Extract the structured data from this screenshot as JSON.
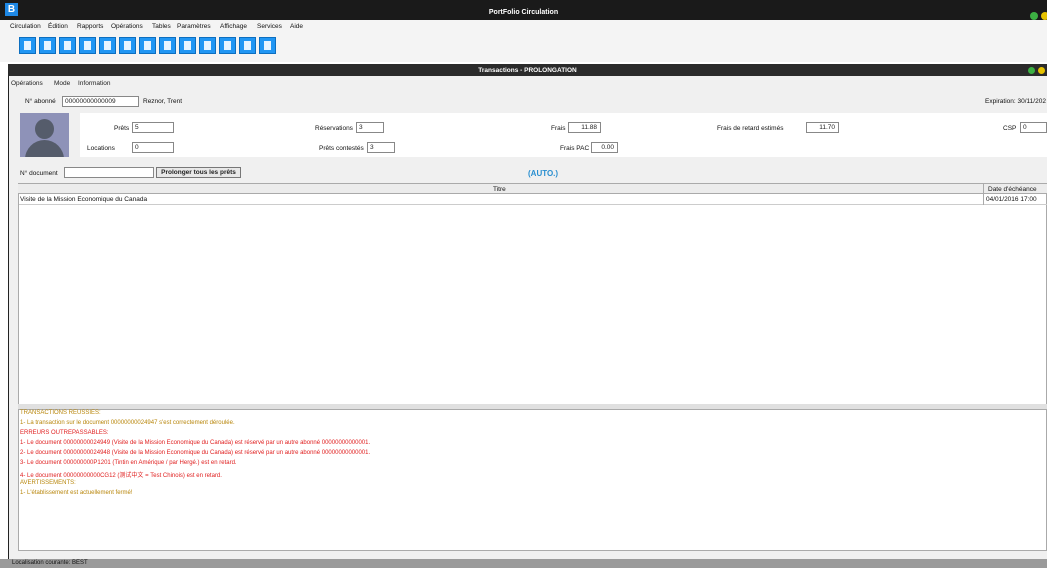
{
  "app": {
    "title": "PortFolio Circulation",
    "logo": "B"
  },
  "menubar": [
    "Circulation",
    "Édition",
    "Rapports",
    "Opérations",
    "Tables",
    "Paramètres",
    "Affichage",
    "Services",
    "Aide"
  ],
  "toolbar": {
    "icons": [
      "document-icon",
      "document-icon",
      "document-icon",
      "list-icon",
      "upload-icon",
      "download-icon",
      "list-icon",
      "user-card-icon",
      "user-card-icon",
      "report-icon",
      "scissors-icon",
      "copy-icon",
      "paste-icon"
    ],
    "color": "#2196f3"
  },
  "window": {
    "title": "Transactions - PROLONGATION",
    "menu": [
      "Opérations",
      "Mode",
      "Information"
    ]
  },
  "patron": {
    "label": "N° abonné",
    "number": "00000000000009",
    "name": "Reznor, Trent",
    "expiration": "Expiration: 30/11/202",
    "prets_label": "Prêts",
    "prets": "5",
    "locations_label": "Locations",
    "locations": "0",
    "reservations_label": "Réservations",
    "reservations": "3",
    "prets_contestes_label": "Prêts contestés",
    "prets_contestes": "3",
    "frais_label": "Frais",
    "frais": "11.88",
    "frais_pac_label": "Frais PAC",
    "frais_pac": "0.00",
    "frais_retard_label": "Frais de retard estimés",
    "frais_retard": "11.70",
    "csp_label": "CSP",
    "csp": "0"
  },
  "document": {
    "label": "N° document",
    "value": "",
    "button": "Prolonger tous les prêts",
    "mode": "(AUTO.)"
  },
  "table": {
    "columns": [
      "Titre",
      "Date d'échéance"
    ],
    "rows": [
      {
        "titre": "Visite de la Mission Economique du Canada",
        "date": "04/01/2016  17:00"
      }
    ]
  },
  "messages": [
    {
      "text": "TRANSACTIONS REUSSIES:",
      "type": "ok"
    },
    {
      "text": "1- La transaction sur le document 00000000024947 s'est correctement déroulée.",
      "type": "ok"
    },
    {
      "text": "ERREURS OUTREPASSABLES:",
      "type": "err"
    },
    {
      "text": "1- Le document 00000000024949 (Visite de la Mission Economique du Canada) est réservé par un autre abonné 00000000000001.",
      "type": "err"
    },
    {
      "text": "2- Le document 00000000024948 (Visite de la Mission Economique du Canada) est réservé par un autre abonné 00000000000001.",
      "type": "err"
    },
    {
      "text": "3- Le document 000000000P1201 (Tintin en Amérique / par Hergé.) est en retard.",
      "type": "err"
    },
    {
      "text": "4- Le document 00000000000CG12 (测试中文 = Test Chinois) est en retard.",
      "type": "err"
    },
    {
      "text": "AVERTISSEMENTS:",
      "type": "ok"
    },
    {
      "text": "1- L'établissement est actuellement fermé!",
      "type": "ok"
    }
  ],
  "statusbar": {
    "text": "Localisation courante: BEST"
  },
  "colors": {
    "ok": "#b8860b",
    "err": "#e02020",
    "auto": "#2a8fd0",
    "titlebar": "#1a1a1a"
  }
}
